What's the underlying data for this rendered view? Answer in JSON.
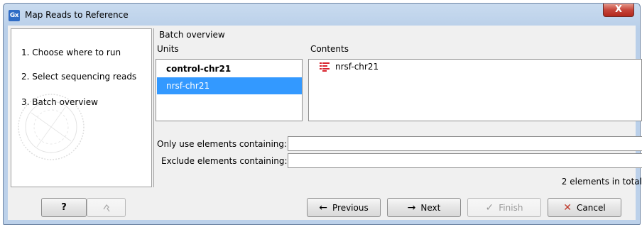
{
  "window": {
    "title": "Map Reads to Reference",
    "icon_text": "Gx",
    "close_label": "X"
  },
  "steps": [
    {
      "label": "1.  Choose where to run"
    },
    {
      "label": "2.  Select sequencing reads"
    },
    {
      "label": "3.  Batch overview"
    }
  ],
  "batch": {
    "section_title": "Batch overview",
    "units_header": "Units",
    "contents_header": "Contents",
    "units": [
      {
        "label": "control-chr21"
      },
      {
        "label": "nrsf-chr21"
      }
    ],
    "contents": [
      {
        "label": "nrsf-chr21",
        "icon": "sequence-list-icon"
      }
    ],
    "include_label": "Only use elements containing:",
    "include_value": "",
    "exclude_label": "Exclude elements containing:",
    "exclude_value": "",
    "summary": "2 elements in total"
  },
  "buttons": {
    "help": "?",
    "previous": "Previous",
    "next": "Next",
    "finish": "Finish",
    "cancel": "Cancel"
  },
  "colors": {
    "selection": "#3399ff",
    "cancel_x": "#c0392b",
    "list_icon": "#d9232e"
  }
}
